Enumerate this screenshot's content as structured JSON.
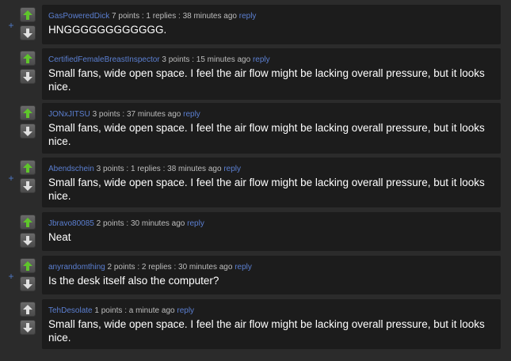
{
  "comments": [
    {
      "author": "GasPoweredDick",
      "points": "7 points",
      "replies": "1 replies",
      "time": "38 minutes ago",
      "reply_label": "reply",
      "text": "HNGGGGGGGGGGGG.",
      "has_expand": true,
      "upvoted": true,
      "expand_label": "+"
    },
    {
      "author": "CertifiedFemaleBreastInspector",
      "points": "3 points",
      "time": "15 minutes ago",
      "reply_label": "reply",
      "text": "Small fans, wide open space. I feel the air flow might be lacking overall pressure, but it looks nice.",
      "has_expand": false,
      "upvoted": true
    },
    {
      "author": "JONxJITSU",
      "points": "3 points",
      "time": "37 minutes ago",
      "reply_label": "reply",
      "text": "Small fans, wide open space. I feel the air flow might be lacking overall pressure, but it looks nice.",
      "has_expand": false,
      "upvoted": true
    },
    {
      "author": "Abendschein",
      "points": "3 points",
      "replies": "1 replies",
      "time": "38 minutes ago",
      "reply_label": "reply",
      "text": "Small fans, wide open space. I feel the air flow might be lacking overall pressure, but it looks nice.",
      "has_expand": true,
      "upvoted": true,
      "expand_label": "+"
    },
    {
      "author": "Jbravo80085",
      "points": "2 points",
      "time": "30 minutes ago",
      "reply_label": "reply",
      "text": "Neat",
      "has_expand": false,
      "upvoted": true
    },
    {
      "author": "anyrandomthing",
      "points": "2 points",
      "replies": "2 replies",
      "time": "30 minutes ago",
      "reply_label": "reply",
      "text": "Is the desk itself also the computer?",
      "has_expand": true,
      "upvoted": true,
      "expand_label": "+"
    },
    {
      "author": "TehDesolate",
      "points": "1 points",
      "time": "a minute ago",
      "reply_label": "reply",
      "text": "Small fans, wide open space. I feel the air flow might be lacking overall pressure, but it looks nice.",
      "has_expand": false,
      "upvoted": false
    }
  ],
  "separator": ":",
  "colors": {
    "upvote_active": "#5fc52b",
    "vote_inactive": "#e0e0e0",
    "link": "#5b7fd1"
  },
  "icons": {
    "upvote": "upvote-arrow-icon",
    "downvote": "downvote-arrow-icon"
  }
}
